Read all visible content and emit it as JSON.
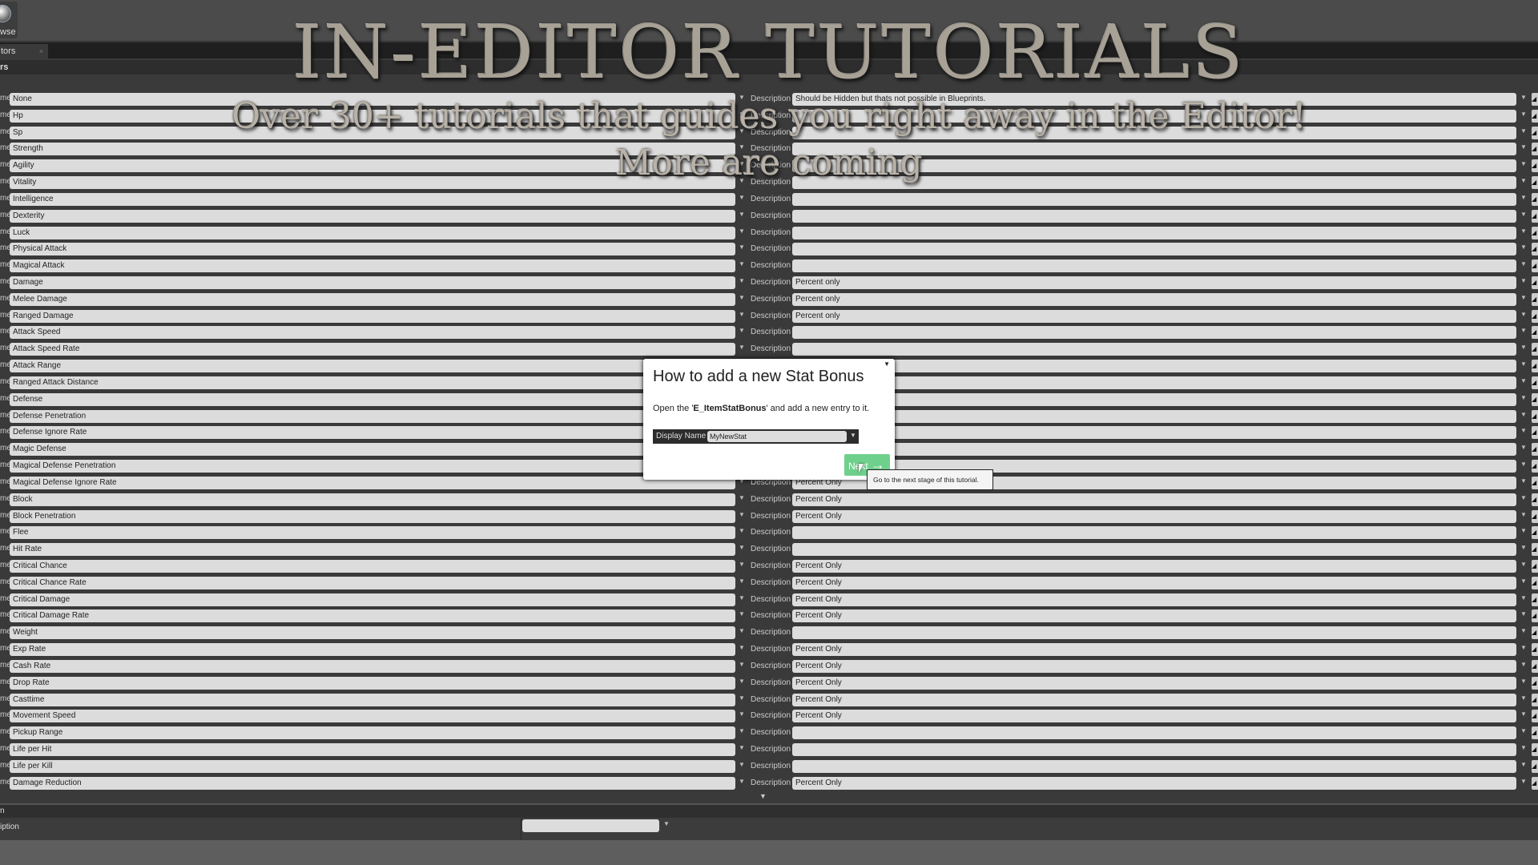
{
  "toolbar": {
    "browse_label": "wse"
  },
  "tab": {
    "label": "tors",
    "close": "×"
  },
  "header": {
    "label": "rs"
  },
  "labels": {
    "name": "me",
    "description": "Description"
  },
  "rows": [
    {
      "name": "None",
      "desc": "Should be Hidden but thats not possible in Blueprints."
    },
    {
      "name": "Hp",
      "desc": ""
    },
    {
      "name": "Sp",
      "desc": ""
    },
    {
      "name": "Strength",
      "desc": ""
    },
    {
      "name": "Agility",
      "desc": ""
    },
    {
      "name": "Vitality",
      "desc": ""
    },
    {
      "name": "Intelligence",
      "desc": ""
    },
    {
      "name": "Dexterity",
      "desc": ""
    },
    {
      "name": "Luck",
      "desc": ""
    },
    {
      "name": "Physical Attack",
      "desc": ""
    },
    {
      "name": "Magical Attack",
      "desc": ""
    },
    {
      "name": "Damage",
      "desc": "Percent only"
    },
    {
      "name": "Melee Damage",
      "desc": "Percent only"
    },
    {
      "name": "Ranged Damage",
      "desc": "Percent only"
    },
    {
      "name": "Attack Speed",
      "desc": ""
    },
    {
      "name": "Attack Speed Rate",
      "desc": ""
    },
    {
      "name": "Attack Range",
      "desc": ""
    },
    {
      "name": "Ranged Attack Distance",
      "desc": ""
    },
    {
      "name": "Defense",
      "desc": ""
    },
    {
      "name": "Defense Penetration",
      "desc": ""
    },
    {
      "name": "Defense Ignore Rate",
      "desc": ""
    },
    {
      "name": "Magic Defense",
      "desc": ""
    },
    {
      "name": "Magical Defense Penetration",
      "desc": ""
    },
    {
      "name": "Magical Defense Ignore Rate",
      "desc": "Percent Only"
    },
    {
      "name": "Block",
      "desc": "Percent Only"
    },
    {
      "name": "Block Penetration",
      "desc": "Percent Only"
    },
    {
      "name": "Flee",
      "desc": ""
    },
    {
      "name": "Hit Rate",
      "desc": ""
    },
    {
      "name": "Critical Chance",
      "desc": "Percent Only"
    },
    {
      "name": "Critical Chance Rate",
      "desc": "Percent Only"
    },
    {
      "name": "Critical Damage",
      "desc": "Percent Only"
    },
    {
      "name": "Critical Damage Rate",
      "desc": "Percent Only"
    },
    {
      "name": "Weight",
      "desc": ""
    },
    {
      "name": "Exp Rate",
      "desc": "Percent Only"
    },
    {
      "name": "Cash Rate",
      "desc": "Percent Only"
    },
    {
      "name": "Drop Rate",
      "desc": "Percent Only"
    },
    {
      "name": "Casttime",
      "desc": "Percent Only"
    },
    {
      "name": "Movement Speed",
      "desc": "Percent Only"
    },
    {
      "name": "Pickup Range",
      "desc": ""
    },
    {
      "name": "Life per Hit",
      "desc": ""
    },
    {
      "name": "Life per Kill",
      "desc": ""
    },
    {
      "name": "Damage Reduction",
      "desc": "Percent Only"
    }
  ],
  "bottom": {
    "section": "n",
    "field_label": "iption"
  },
  "overlay": {
    "title": "IN-EDITOR TUTORIALS",
    "subtitle1": "Over 30+ tutorials that guides you right away in the Editor!",
    "subtitle2": "More are coming"
  },
  "dialog": {
    "title": "How to add a new Stat Bonus",
    "text_pre": "Open the '",
    "text_bold": "E_ItemStatBonus",
    "text_post": "' and add a new entry to it.",
    "field_label": "Display Name",
    "field_value": "MyNewStat",
    "next_label": "Next",
    "next_icon": "arrow-right-icon",
    "tooltip": "Go to the next stage of this tutorial.",
    "accent": "#6fd08c"
  }
}
